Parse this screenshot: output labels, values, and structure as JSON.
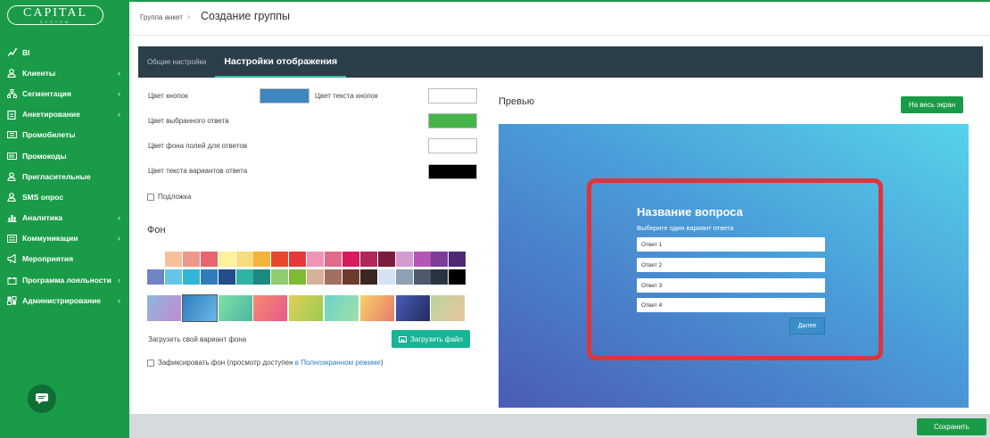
{
  "brand": {
    "logo_main": "CAPITAL",
    "logo_sub": "SYSTEM"
  },
  "sidebar": {
    "items": [
      {
        "label": "BI",
        "icon": "chart-line-icon",
        "chevron": false
      },
      {
        "label": "Клиенты",
        "icon": "user-icon",
        "chevron": true
      },
      {
        "label": "Сегментация",
        "icon": "sitemap-icon",
        "chevron": true
      },
      {
        "label": "Анкетирование",
        "icon": "clipboard-icon",
        "chevron": true
      },
      {
        "label": "Промобилеты",
        "icon": "ticket-icon",
        "chevron": false
      },
      {
        "label": "Промокоды",
        "icon": "barcode-icon",
        "chevron": false
      },
      {
        "label": "Пригласительные",
        "icon": "user-icon",
        "chevron": false
      },
      {
        "label": "SMS опрос",
        "icon": "user-icon",
        "chevron": false
      },
      {
        "label": "Аналитика",
        "icon": "bar-chart-icon",
        "chevron": true
      },
      {
        "label": "Коммуникации",
        "icon": "list-icon",
        "chevron": true
      },
      {
        "label": "Мероприятия",
        "icon": "megaphone-icon",
        "chevron": false
      },
      {
        "label": "Программа лояльности",
        "icon": "gift-icon",
        "chevron": true
      },
      {
        "label": "Администрирование",
        "icon": "settings-icon",
        "chevron": true
      }
    ],
    "chevron_glyph": "‹"
  },
  "header": {
    "breadcrumb": "Группа анкет",
    "breadcrumb_sep": ">",
    "title": "Создание группы"
  },
  "tabs": [
    {
      "label": "Общие настройки",
      "active": false
    },
    {
      "label": "Настройки отображения",
      "active": true
    }
  ],
  "settings": {
    "button_color_label": "Цвет кнопок",
    "button_color": "#3e86be",
    "button_text_color_label": "Цвет текста кнопок",
    "button_text_color": "#ffffff",
    "selected_answer_color_label": "Цвет выбранного ответа",
    "selected_answer_color": "#44b649",
    "answer_field_bg_label": "Цвет фона полей для ответов",
    "answer_field_bg": "#ffffff",
    "answer_text_color_label": "Цвет текста вариантов ответа",
    "answer_text_color": "#000000",
    "underlay_label": "Подложка"
  },
  "background": {
    "title": "Фон",
    "palette_row1": [
      "#ffffff",
      "#f4c19a",
      "#ee988a",
      "#e8646e",
      "#fbf29a",
      "#f8dc7f",
      "#f4b33c",
      "#e5492d",
      "#e33a3c",
      "#ef94b6",
      "#e16b8a",
      "#d81b60",
      "#b0275a",
      "#7a1c3c",
      "#d39ad0",
      "#b556b5",
      "#7e3b98",
      "#4d2a73"
    ],
    "palette_row2": [
      "#6f84c4",
      "#64c5e8",
      "#32b6d8",
      "#2f7dbd",
      "#234d8b",
      "#2fb3a2",
      "#1c8b7e",
      "#8fcd6f",
      "#7fba35",
      "#d6b29a",
      "#a07060",
      "#6d3b2c",
      "#3a2820",
      "#d3e3f3",
      "#8ea0b4",
      "#4e5a6a",
      "#2a3440",
      "#000000"
    ],
    "gradients": [
      [
        "#8fb6e0",
        "#c08bd0"
      ],
      [
        "#2f7dbd",
        "#6bb7e8"
      ],
      [
        "#7ee0a8",
        "#4fb7a0"
      ],
      [
        "#f58a6f",
        "#e85a8b"
      ],
      [
        "#e0d05a",
        "#9acb4e"
      ],
      [
        "#6bd3c8",
        "#a0e0a8"
      ],
      [
        "#f7d36a",
        "#e87a6a"
      ],
      [
        "#4a5cb5",
        "#232a5e"
      ],
      [
        "#b8d6a0",
        "#e8c59a"
      ]
    ],
    "upload_label": "Загрузить свой вариант фона",
    "upload_button": "Загрузить файл",
    "fix_label": "Зафиксировать фон (просмотр доступен",
    "fix_link": "в Полноэкранном режиме",
    "fix_tail": ")"
  },
  "preview": {
    "title": "Превью",
    "fullscreen_button": "На весь экран",
    "question_title": "Название вопроса",
    "question_sub": "Выберите один вариант ответа",
    "answers": [
      "Ответ 1",
      "Ответ 2",
      "Ответ 3",
      "Ответ 4"
    ],
    "next_button": "Далее"
  },
  "footer": {
    "save_button": "Сохранить"
  }
}
